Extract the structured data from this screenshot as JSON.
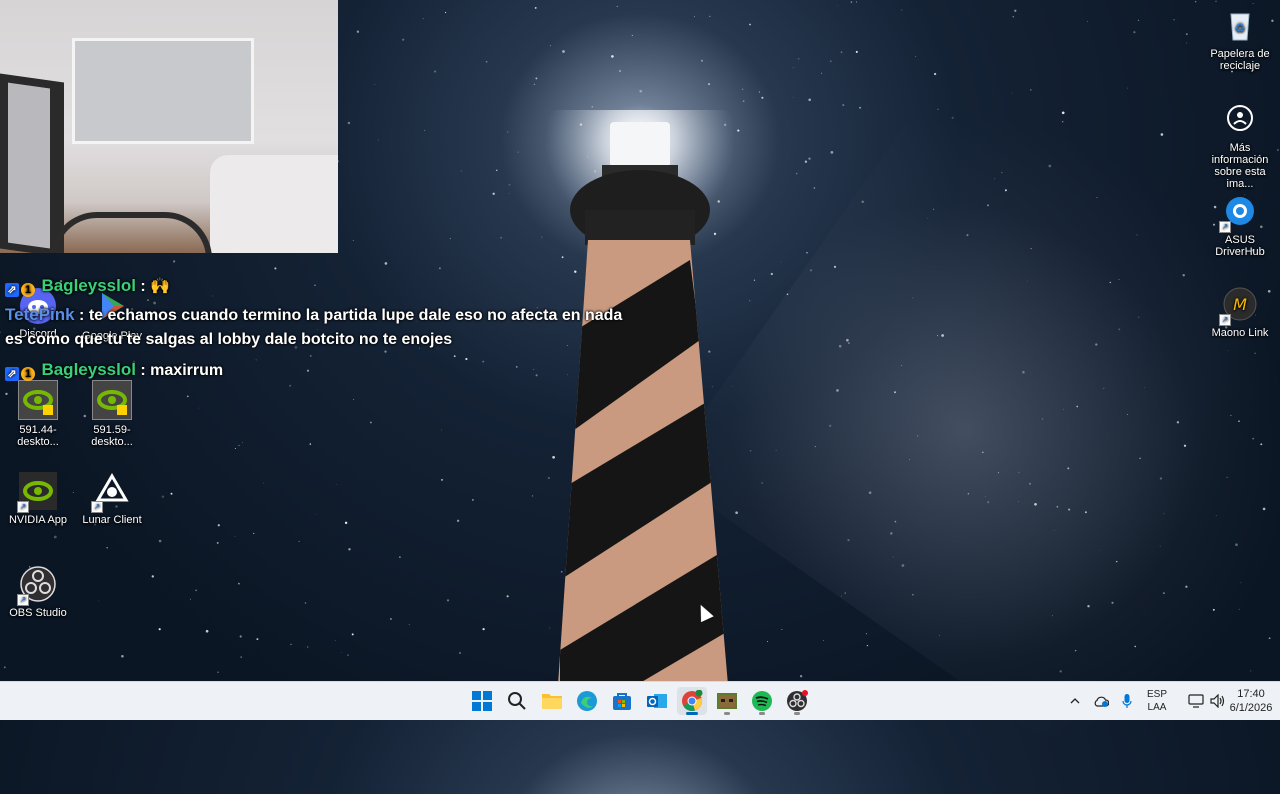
{
  "webcam": {},
  "chat": {
    "messages": [
      {
        "user": "Bagleysslol",
        "user_color": "#3ad07a",
        "sep": " : ",
        "text": "🙌"
      },
      {
        "user": "TetePink",
        "user_color": "#5a8fe8",
        "sep": " : ",
        "text": "te echamos cuando termino la partida lupe dale eso no afecta en nada"
      },
      {
        "continuation": "es como que tu te salgas al lobby dale botcito no te enojes"
      },
      {
        "user": "Bagleysslol",
        "user_color": "#3ad07a",
        "sep": " : ",
        "text": "maxirrum"
      }
    ],
    "badges": {
      "prime": "⇗",
      "sub": "1"
    }
  },
  "desktop_left": [
    {
      "label": "Discord",
      "icon": "discord-icon",
      "color": "#5865f2"
    },
    {
      "label": "Google Play",
      "icon": "google-play-icon",
      "color": "#34a853"
    },
    {
      "label": "591.44-deskto...",
      "icon": "nvidia-installer-icon",
      "color": "#76b900"
    },
    {
      "label": "591.59-deskto...",
      "icon": "nvidia-installer-icon",
      "color": "#76b900"
    },
    {
      "label": "NVIDIA App",
      "icon": "nvidia-icon",
      "color": "#76b900"
    },
    {
      "label": "Lunar Client",
      "icon": "lunar-client-icon",
      "color": "#ffffff"
    },
    {
      "label": "OBS Studio",
      "icon": "obs-icon",
      "color": "#302e31"
    }
  ],
  "desktop_right": [
    {
      "label": "Papelera de reciclaje",
      "icon": "recycle-bin-icon"
    },
    {
      "label": "Más información sobre esta ima...",
      "icon": "info-camera-icon"
    },
    {
      "label": "ASUS DriverHub",
      "icon": "asus-driverhub-icon"
    },
    {
      "label": "Maono Link",
      "icon": "maono-link-icon"
    }
  ],
  "taskbar": {
    "apps": [
      {
        "name": "start",
        "icon": "windows-start-icon"
      },
      {
        "name": "search",
        "icon": "search-icon"
      },
      {
        "name": "file-explorer",
        "icon": "folder-icon"
      },
      {
        "name": "edge",
        "icon": "edge-icon"
      },
      {
        "name": "store",
        "icon": "store-icon"
      },
      {
        "name": "outlook",
        "icon": "outlook-icon"
      },
      {
        "name": "chrome",
        "icon": "chrome-icon",
        "active": true
      },
      {
        "name": "minecraft",
        "icon": "minecraft-icon",
        "running": true
      },
      {
        "name": "spotify",
        "icon": "spotify-icon",
        "running": true
      },
      {
        "name": "obs",
        "icon": "obs-icon",
        "running": true
      }
    ],
    "tray": {
      "language_top": "ESP",
      "language_bottom": "LAA",
      "time": "17:40",
      "date": "6/1/2026"
    }
  }
}
